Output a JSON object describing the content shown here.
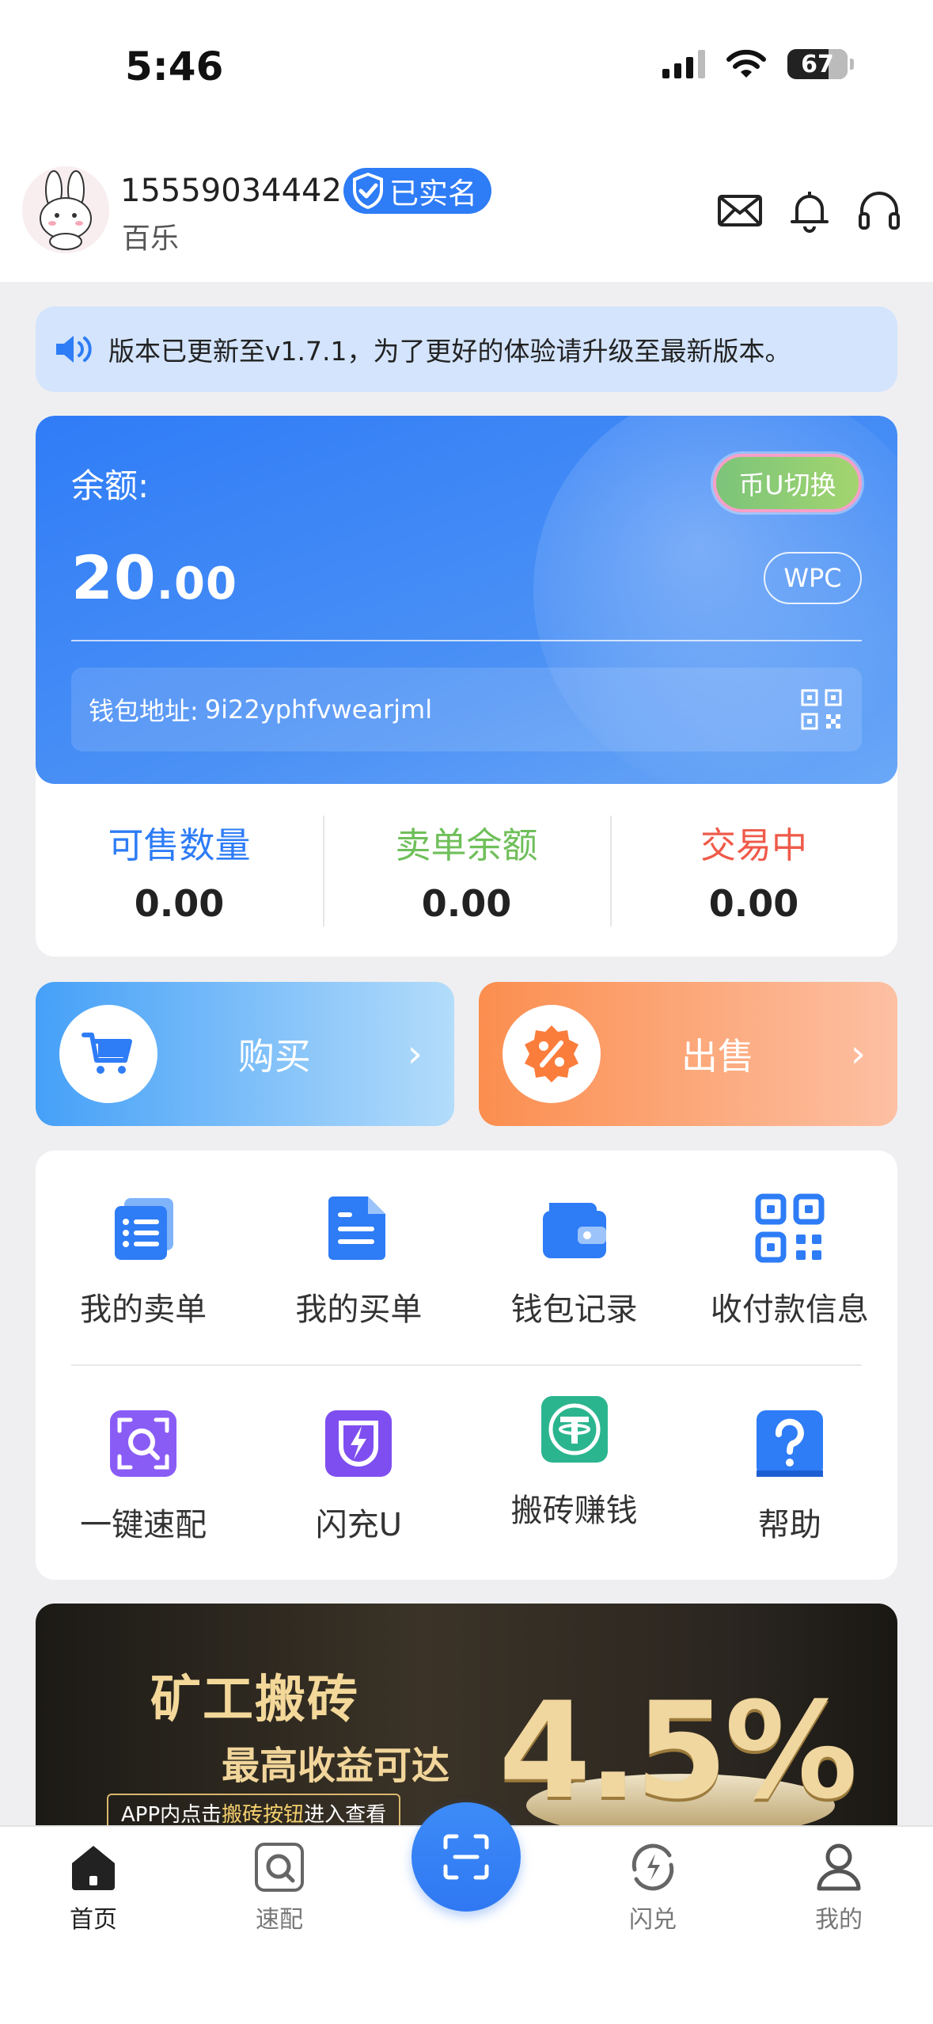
{
  "status_bar": {
    "time": "5:46",
    "battery": "67"
  },
  "header": {
    "phone": "15559034442",
    "verified_label": "已实名",
    "subname": "百乐"
  },
  "notice": {
    "text": "版本已更新至v1.7.1，为了更好的体验请升级至最新版本。"
  },
  "wallet": {
    "balance_label": "余额:",
    "balance_int": "20",
    "balance_dec": ".00",
    "switch_label": "币U切换",
    "currency": "WPC",
    "address_label": "钱包地址:",
    "address_value": "9i22yphfvwearjml"
  },
  "stats": [
    {
      "label": "可售数量",
      "value": "0.00",
      "color": "#2e7cf6"
    },
    {
      "label": "卖单余额",
      "value": "0.00",
      "color": "#6fbf5a"
    },
    {
      "label": "交易中",
      "value": "0.00",
      "color": "#ef5a4a"
    }
  ],
  "trade": {
    "buy_label": "购买",
    "sell_label": "出售",
    "arrow": "›"
  },
  "grid": {
    "row1": [
      {
        "label": "我的卖单",
        "icon": "sell-orders-icon"
      },
      {
        "label": "我的买单",
        "icon": "buy-orders-icon"
      },
      {
        "label": "钱包记录",
        "icon": "wallet-record-icon"
      },
      {
        "label": "收付款信息",
        "icon": "payment-qr-icon"
      }
    ],
    "row2": [
      {
        "label": "一键速配",
        "icon": "quick-match-icon"
      },
      {
        "label": "闪充U",
        "icon": "flash-charge-icon"
      },
      {
        "label": "搬砖赚钱",
        "icon": "tether-icon"
      },
      {
        "label": "帮助",
        "icon": "help-icon"
      }
    ]
  },
  "banner": {
    "title": "矿工搬砖",
    "subtitle": "最高收益可达",
    "percent": "4.5%",
    "note_prefix": "APP内点击",
    "note_highlight": "搬砖按钮",
    "note_suffix": "进入查看"
  },
  "tabbar": [
    {
      "label": "首页",
      "icon": "home-icon",
      "active": true
    },
    {
      "label": "速配",
      "icon": "match-icon",
      "active": false
    },
    {
      "label": "闪兑",
      "icon": "exchange-icon",
      "active": false
    },
    {
      "label": "我的",
      "icon": "profile-icon",
      "active": false
    }
  ],
  "colors": {
    "primary": "#2e7cf6",
    "buy": "#45a0f8",
    "sell": "#fb8e4f"
  }
}
